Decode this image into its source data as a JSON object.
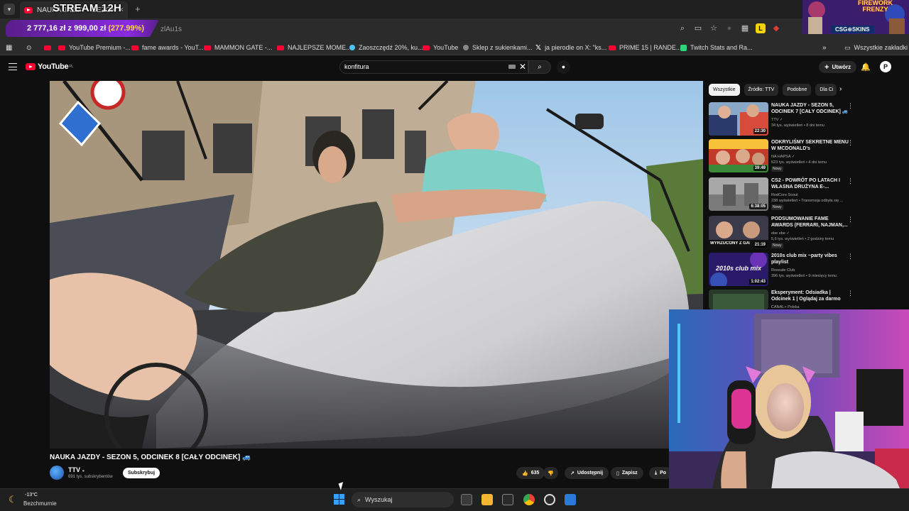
{
  "browser": {
    "tab_title": "NAUKA JAZDY - SEZON 5",
    "tab_close": "×",
    "new_tab": "+",
    "url_fragment": "zlAu1s",
    "bookmarks": [
      {
        "label": "YouTube Premium -...",
        "icon": "youtube"
      },
      {
        "label": "fame awards - YouT...",
        "icon": "youtube"
      },
      {
        "label": "MAMMON GATE -...",
        "icon": "youtube"
      },
      {
        "label": "NAJLEPSZE MOME...",
        "icon": "youtube"
      },
      {
        "label": "Zaoszczędź 20%, ku...",
        "icon": "check"
      },
      {
        "label": "YouTube",
        "icon": "youtube"
      },
      {
        "label": "Sklep z sukienkami...",
        "icon": "shop"
      },
      {
        "label": "ja pierodle on X: \"ks...",
        "icon": "x"
      },
      {
        "label": "PRIME 15 | RANDE...",
        "icon": "youtube"
      },
      {
        "label": "Twitch Stats and Ra...",
        "icon": "twitch-tracker"
      }
    ],
    "all_bookmarks": "Wszystkie zakładki"
  },
  "stream_overlay": {
    "title": "STREAM 12H",
    "donation_amount": "2 777,16 zł",
    "donation_of": "z",
    "donation_goal": "999,00 zł",
    "donation_pct": "(277.99%)",
    "promo_top": "FIREWORK\nFRENZY",
    "promo_brand": "CSG⊕SKINS"
  },
  "youtube": {
    "logo_text": "YouTube",
    "logo_region": "PL",
    "search_value": "konfitura",
    "search_clear": "✕",
    "create_label": "Utwórz",
    "avatar_letter": "P"
  },
  "video": {
    "title": "NAUKA JAZDY - SEZON 5, ODCINEK 8 [CAŁY ODCINEK] 🚙",
    "channel": "TTV",
    "subscribers": "691 tys. subskrybentów",
    "subscribe_label": "Subskrybuj",
    "likes": "635",
    "share_label": "Udostępnij",
    "save_label": "Zapisz",
    "download_label": "Po"
  },
  "sidebar": {
    "chips": [
      "Wszystkie",
      "Źródło: TTV",
      "Podobne",
      "Dla Ci"
    ],
    "recommendations": [
      {
        "title": "NAUKA JAZDY - SEZON 5, ODCINEK 7 [CAŁY ODCINEK] 🚙",
        "channel": "TTV ✓",
        "meta": "34 tys. wyświetleń • 8 dni temu",
        "duration": "22:30",
        "badge": ""
      },
      {
        "title": "ODKRYLIŚMY SEKRETNE MENU W MCDONALD's",
        "channel": "NA HAPSA ✓",
        "meta": "523 tys. wyświetleń • 4 dni temu",
        "duration": "39:49",
        "badge": "Nowy"
      },
      {
        "title": "CS2 - POWRÓT PO LATACH I WŁASNA DRUŻYNA E-...",
        "channel": "RedCore Scout",
        "meta": "238 wyświetleń • Transmisja odbyła się ...",
        "duration": "6:38:05",
        "badge": "Nowy"
      },
      {
        "title": "PODSUMOWANIE FAME AWARDS (FERRARI, NAJMAN,...",
        "channel": "ebe ebe ✓",
        "meta": "5,6 tys. wyświetleń • 2 godziny temu",
        "duration": "21:19",
        "badge": "Nowy",
        "thumb_text": "WYRZUCONY Z GALI"
      },
      {
        "title": "2010s club mix ~party vibes playlist",
        "channel": "Roseate Club",
        "meta": "396 tys. wyświetleń • 9 miesięcy temu",
        "duration": "1:02:43",
        "badge": "",
        "thumb_text": "2010s club mix"
      },
      {
        "title": "Eksperyment: Odsiadka | Odcinek 1 | Oglądaj za darmo",
        "channel": "CANAL+ Polska",
        "meta": "",
        "duration": "",
        "badge": ""
      }
    ]
  },
  "taskbar": {
    "temperature": "-13°C",
    "weather": "Bezchmurnie",
    "search_placeholder": "Wyszukaj"
  },
  "icons": {
    "search": "⌕",
    "mic": "🎤",
    "bell": "🔔",
    "more": "⋮",
    "chevron-right": "›",
    "like": "👍",
    "dislike": "👎",
    "share": "↗",
    "save": "🔖",
    "download": "⤓",
    "moon": "☾"
  },
  "colors": {
    "youtube_red": "#ff0033",
    "overlay_purple": "#8a2be2",
    "donation_pct": "#ffd54a",
    "windows_blue": "#3aa0ff"
  }
}
